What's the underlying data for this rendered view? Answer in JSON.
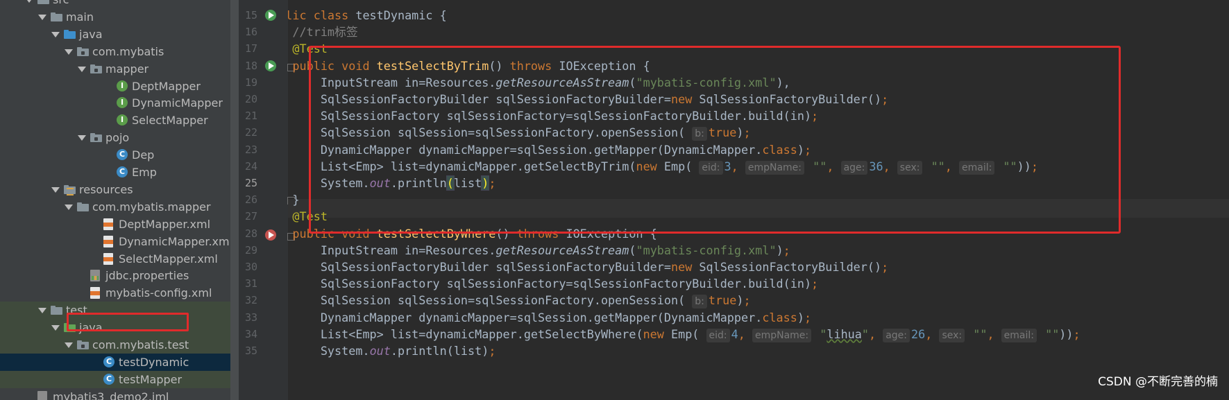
{
  "tree": [
    {
      "label": "src",
      "icon": "folder-icon",
      "depth": 0,
      "open": true
    },
    {
      "label": "main",
      "icon": "folder-icon",
      "depth": 1,
      "open": true
    },
    {
      "label": "java",
      "icon": "folder-blue-icon",
      "depth": 2,
      "open": true
    },
    {
      "label": "com.mybatis",
      "icon": "package-icon",
      "depth": 3,
      "open": true
    },
    {
      "label": "mapper",
      "icon": "package-icon",
      "depth": 4,
      "open": true
    },
    {
      "label": "DeptMapper",
      "icon": "interface-icon",
      "depth": 6
    },
    {
      "label": "DynamicMapper",
      "icon": "interface-icon",
      "depth": 6
    },
    {
      "label": "SelectMapper",
      "icon": "interface-icon",
      "depth": 6
    },
    {
      "label": "pojo",
      "icon": "package-icon",
      "depth": 4,
      "open": true
    },
    {
      "label": "Dep",
      "icon": "class-icon",
      "depth": 6
    },
    {
      "label": "Emp",
      "icon": "class-icon",
      "depth": 6
    },
    {
      "label": "resources",
      "icon": "resources-icon",
      "depth": 2,
      "open": true
    },
    {
      "label": "com.mybatis.mapper",
      "icon": "folder-icon",
      "depth": 3,
      "open": true
    },
    {
      "label": "DeptMapper.xml",
      "icon": "xml-file-icon",
      "depth": 5
    },
    {
      "label": "DynamicMapper.xml",
      "icon": "xml-file-icon",
      "depth": 5
    },
    {
      "label": "SelectMapper.xml",
      "icon": "xml-file-icon",
      "depth": 5
    },
    {
      "label": "jdbc.properties",
      "icon": "properties-file-icon",
      "depth": 4
    },
    {
      "label": "mybatis-config.xml",
      "icon": "xml-file-icon",
      "depth": 4
    },
    {
      "label": "test",
      "icon": "folder-icon",
      "depth": 1,
      "open": true,
      "state": "hl"
    },
    {
      "label": "java",
      "icon": "folder-green-icon",
      "depth": 2,
      "open": true,
      "state": "hl"
    },
    {
      "label": "com.mybatis.test",
      "icon": "package-icon",
      "depth": 3,
      "open": true,
      "state": "hl"
    },
    {
      "label": "testDynamic",
      "icon": "class-icon",
      "depth": 5,
      "state": "sel"
    },
    {
      "label": "testMapper",
      "icon": "class-icon",
      "depth": 5,
      "state": "hl"
    },
    {
      "label": "mybatis3_demo2.iml",
      "icon": "iml-file-icon",
      "depth": 0
    }
  ],
  "gutter": {
    "line_numbers": [
      "15",
      "16",
      "17",
      "18",
      "19",
      "20",
      "21",
      "22",
      "23",
      "24",
      "25",
      "26",
      "27",
      "28",
      "29",
      "30",
      "31",
      "32",
      "33",
      "34",
      "35"
    ],
    "current_line": "25"
  },
  "code_lines": [
    [
      [
        "kw",
        "public class "
      ],
      [
        "",
        "testDynamic {"
      ]
    ],
    [
      [
        "cmt",
        "    //trim标签"
      ]
    ],
    [
      [
        "ann",
        "    @Test"
      ]
    ],
    [
      [
        "kw",
        "    public void "
      ],
      [
        "fn",
        "testSelectByTrim"
      ],
      [
        "",
        "() "
      ],
      [
        "kw",
        "throws "
      ],
      [
        "",
        "IOException {"
      ]
    ],
    [
      [
        "",
        "        InputStream in=Resources."
      ],
      [
        "mi",
        "getResourceAsStream"
      ],
      [
        "",
        "("
      ],
      [
        "str",
        "\"mybatis-config.xml\""
      ],
      [
        "",
        "),"
      ],
      [
        "kw",
        ""
      ]
    ],
    [
      [
        "",
        "        SqlSessionFactoryBuilder sqlSessionFactoryBuilder="
      ],
      [
        "kw",
        "new "
      ],
      [
        "",
        "SqlSessionFactoryBuilder()"
      ],
      [
        "kw",
        ";"
      ]
    ],
    [
      [
        "",
        "        SqlSessionFactory sqlSessionFactory=sqlSessionFactoryBuilder.build(in)"
      ],
      [
        "kw",
        ";"
      ]
    ],
    [
      [
        "",
        "        SqlSession sqlSession=sqlSessionFactory.openSession( "
      ],
      [
        "hint",
        "b:"
      ],
      [
        "kw",
        "true"
      ],
      [
        "",
        ")"
      ],
      [
        "kw",
        ";"
      ]
    ],
    [
      [
        "",
        "        DynamicMapper dynamicMapper=sqlSession.getMapper(DynamicMapper."
      ],
      [
        "kw",
        "class"
      ],
      [
        "",
        ")"
      ],
      [
        "kw",
        ";"
      ]
    ],
    [
      [
        "",
        "        List<Emp> list=dynamicMapper.getSelectByTrim("
      ],
      [
        "kw",
        "new "
      ],
      [
        "",
        "Emp( "
      ],
      [
        "hint",
        "eid:"
      ],
      [
        "num",
        "3"
      ],
      [
        "kw",
        ", "
      ],
      [
        "hint",
        "empName:"
      ],
      [
        "str",
        " \"\""
      ],
      [
        "kw",
        ", "
      ],
      [
        "hint",
        "age:"
      ],
      [
        "num",
        "36"
      ],
      [
        "kw",
        ", "
      ],
      [
        "hint",
        "sex:"
      ],
      [
        "str",
        " \"\""
      ],
      [
        "kw",
        ", "
      ],
      [
        "hint",
        "email:"
      ],
      [
        "str",
        " \"\""
      ],
      [
        "",
        "))"
      ],
      [
        "kw",
        ";"
      ]
    ],
    [
      [
        "",
        "        System."
      ],
      [
        "fld",
        "out"
      ],
      [
        "",
        ".println"
      ],
      [
        "brace-match",
        "("
      ],
      [
        "",
        "list"
      ],
      [
        "brace-match",
        ")"
      ],
      [
        "kw",
        ";"
      ]
    ],
    [
      [
        "",
        "    }"
      ]
    ],
    [
      [
        "ann",
        "    @Test"
      ]
    ],
    [
      [
        "kw",
        "    public void "
      ],
      [
        "fn",
        "testSelectByWhere"
      ],
      [
        "",
        "() "
      ],
      [
        "kw",
        "throws "
      ],
      [
        "",
        "IOException {"
      ]
    ],
    [
      [
        "",
        "        InputStream in=Resources."
      ],
      [
        "mi",
        "getResourceAsStream"
      ],
      [
        "",
        "("
      ],
      [
        "str",
        "\"mybatis-config.xml\""
      ],
      [
        "",
        ")"
      ],
      [
        "kw",
        ";"
      ]
    ],
    [
      [
        "",
        "        SqlSessionFactoryBuilder sqlSessionFactoryBuilder="
      ],
      [
        "kw",
        "new "
      ],
      [
        "",
        "SqlSessionFactoryBuilder()"
      ],
      [
        "kw",
        ";"
      ]
    ],
    [
      [
        "",
        "        SqlSessionFactory sqlSessionFactory=sqlSessionFactoryBuilder.build(in)"
      ],
      [
        "kw",
        ";"
      ]
    ],
    [
      [
        "",
        "        SqlSession sqlSession=sqlSessionFactory.openSession( "
      ],
      [
        "hint",
        "b:"
      ],
      [
        "kw",
        "true"
      ],
      [
        "",
        ")"
      ],
      [
        "kw",
        ";"
      ]
    ],
    [
      [
        "",
        "        DynamicMapper dynamicMapper=sqlSession.getMapper(DynamicMapper."
      ],
      [
        "kw",
        "class"
      ],
      [
        "",
        ")"
      ],
      [
        "kw",
        ";"
      ]
    ],
    [
      [
        "",
        "        List<Emp> list=dynamicMapper.getSelectByWhere("
      ],
      [
        "kw",
        "new "
      ],
      [
        "",
        "Emp( "
      ],
      [
        "hint",
        "eid:"
      ],
      [
        "num",
        "4"
      ],
      [
        "kw",
        ", "
      ],
      [
        "hint",
        "empName:"
      ],
      [
        "str",
        " \""
      ],
      [
        "wavy",
        "lihua"
      ],
      [
        "str",
        "\""
      ],
      [
        "kw",
        ", "
      ],
      [
        "hint",
        "age:"
      ],
      [
        "num",
        "26"
      ],
      [
        "kw",
        ", "
      ],
      [
        "hint",
        "sex:"
      ],
      [
        "str",
        " \"\""
      ],
      [
        "kw",
        ", "
      ],
      [
        "hint",
        "email:"
      ],
      [
        "str",
        " \"\""
      ],
      [
        "",
        "))"
      ],
      [
        "kw",
        ";"
      ]
    ],
    [
      [
        "",
        "        System."
      ],
      [
        "fld",
        "out"
      ],
      [
        "",
        ".println(list)"
      ],
      [
        "kw",
        ";"
      ]
    ]
  ],
  "watermark": "CSDN @不断完善的楠"
}
